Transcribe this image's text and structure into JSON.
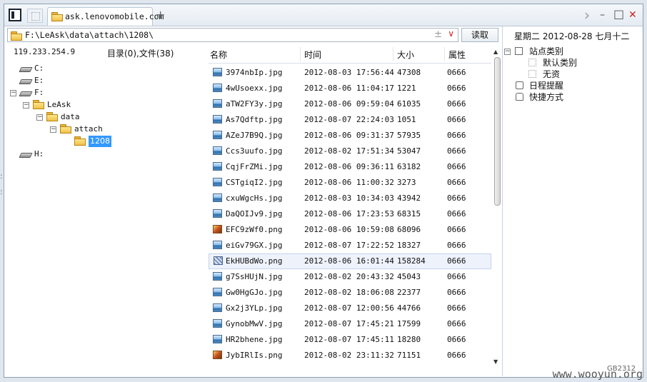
{
  "tab": {
    "title": "ask.lenovomobile.com",
    "new_tab": "+"
  },
  "window_controls": {
    "forward": "›",
    "minimize": "–",
    "maximize": "□",
    "close": "✕"
  },
  "address": {
    "path": "F:\\LeAsk\\data\\attach\\1208\\",
    "star": "±",
    "dropdown": "∨",
    "read_button": "读取"
  },
  "datebar": "星期二  2012-08-28  七月十二",
  "left_panel": {
    "ip": "119.233.254.9",
    "summary": "目录(0),文件(38)"
  },
  "tree": [
    {
      "label": "C:",
      "type": "drive"
    },
    {
      "label": "E:",
      "type": "drive"
    },
    {
      "label": "F:",
      "type": "drive"
    },
    {
      "label": "LeAsk",
      "type": "folder"
    },
    {
      "label": "data",
      "type": "folder"
    },
    {
      "label": "attach",
      "type": "folder"
    },
    {
      "label": "1208",
      "type": "folder"
    },
    {
      "label": "H:",
      "type": "drive"
    }
  ],
  "columns": {
    "name": "名称",
    "time": "时间",
    "size": "大小",
    "attr": "属性"
  },
  "files": [
    {
      "name": "3974nbIp.jpg",
      "time": "2012-08-03 17:56:44",
      "size": "47308",
      "attr": "0666"
    },
    {
      "name": "4wUsoexx.jpg",
      "time": "2012-08-06 11:04:17",
      "size": "1221",
      "attr": "0666"
    },
    {
      "name": "aTW2FY3y.jpg",
      "time": "2012-08-06 09:59:04",
      "size": "61035",
      "attr": "0666"
    },
    {
      "name": "As7Qdftp.jpg",
      "time": "2012-08-07 22:24:03",
      "size": "1051",
      "attr": "0666"
    },
    {
      "name": "AZeJ7B9Q.jpg",
      "time": "2012-08-06 09:31:37",
      "size": "57935",
      "attr": "0666"
    },
    {
      "name": "Ccs3uufo.jpg",
      "time": "2012-08-02 17:51:34",
      "size": "53047",
      "attr": "0666"
    },
    {
      "name": "CqjFrZMi.jpg",
      "time": "2012-08-06 09:36:11",
      "size": "63182",
      "attr": "0666"
    },
    {
      "name": "CSTgiqI2.jpg",
      "time": "2012-08-06 11:00:32",
      "size": "3273",
      "attr": "0666"
    },
    {
      "name": "cxuWgcHs.jpg",
      "time": "2012-08-03 10:34:03",
      "size": "43942",
      "attr": "0666"
    },
    {
      "name": "DaQOIJv9.jpg",
      "time": "2012-08-06 17:23:53",
      "size": "68315",
      "attr": "0666"
    },
    {
      "name": "EFC9zWf0.png",
      "time": "2012-08-06 10:59:08",
      "size": "68096",
      "attr": "0666"
    },
    {
      "name": "eiGv79GX.jpg",
      "time": "2012-08-07 17:22:52",
      "size": "18327",
      "attr": "0666"
    },
    {
      "name": "EkHUBdWo.png",
      "time": "2012-08-06 16:01:44",
      "size": "158284",
      "attr": "0666"
    },
    {
      "name": "g7SsHUjN.jpg",
      "time": "2012-08-02 20:43:32",
      "size": "45043",
      "attr": "0666"
    },
    {
      "name": "Gw0HgGJo.jpg",
      "time": "2012-08-02 18:06:08",
      "size": "22377",
      "attr": "0666"
    },
    {
      "name": "Gx2j3YLp.jpg",
      "time": "2012-08-07 12:00:56",
      "size": "44766",
      "attr": "0666"
    },
    {
      "name": "GynobMwV.jpg",
      "time": "2012-08-07 17:45:21",
      "size": "17599",
      "attr": "0666"
    },
    {
      "name": "HR2bhene.jpg",
      "time": "2012-08-07 17:45:11",
      "size": "18280",
      "attr": "0666"
    },
    {
      "name": "JybIRlIs.png",
      "time": "2012-08-02 23:11:32",
      "size": "71151",
      "attr": "0666"
    }
  ],
  "right_panel": {
    "site_category": "站点类别",
    "default_category": "默认类别",
    "none": "无资",
    "schedule": "日程提醒",
    "shortcut": "快捷方式"
  },
  "encoding": "GB2312",
  "watermark": "www.wooyun.org"
}
